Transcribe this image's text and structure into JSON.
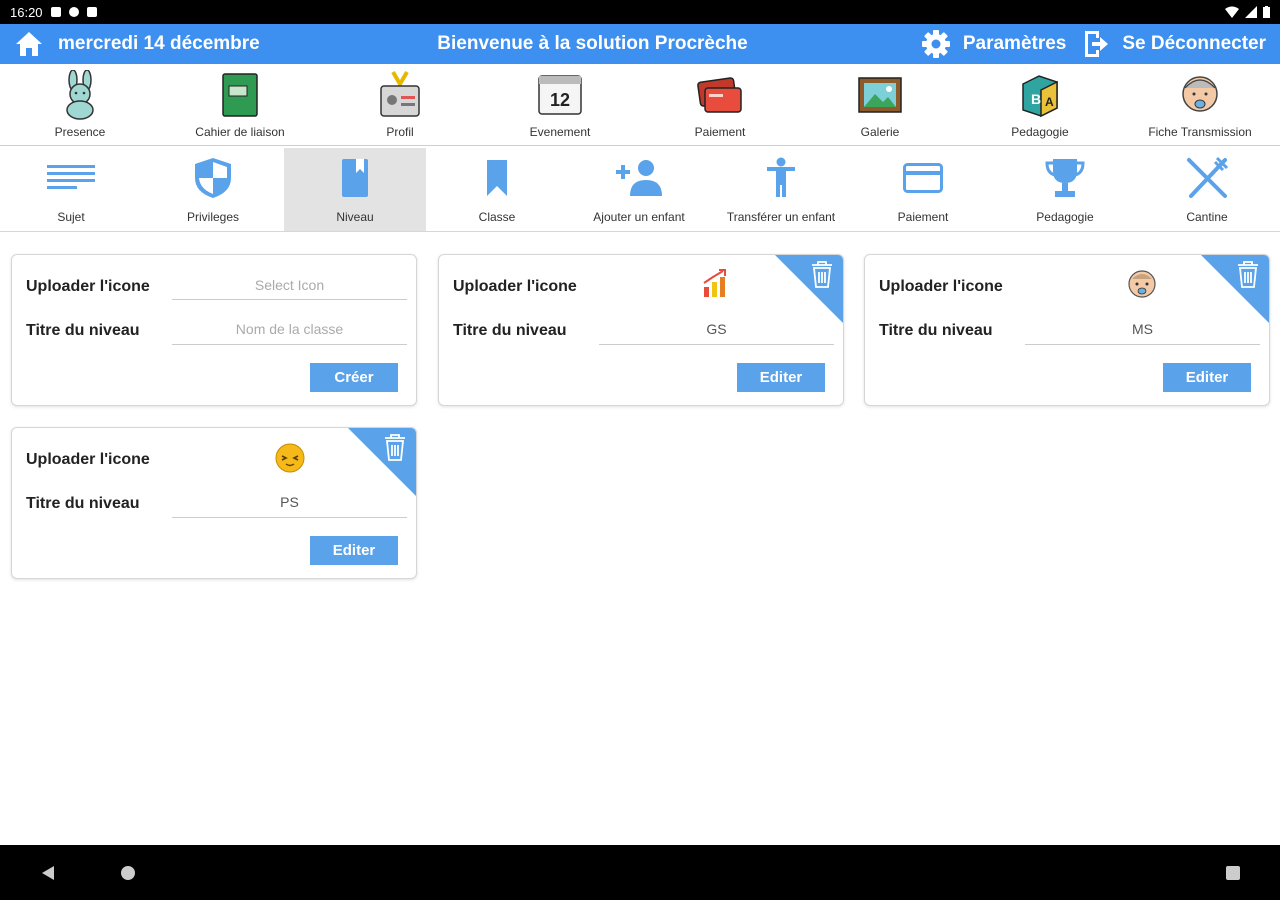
{
  "statusbar": {
    "time": "16:20"
  },
  "topbar": {
    "date": "mercredi 14 décembre",
    "title": "Bienvenue à la solution Procrèche",
    "settings": "Paramètres",
    "logout": "Se Déconnecter",
    "color": "#3d8ff0"
  },
  "modules": [
    {
      "label": "Presence",
      "icon": "bunny-icon"
    },
    {
      "label": "Cahier de liaison",
      "icon": "notebook-icon"
    },
    {
      "label": "Profil",
      "icon": "badge-icon"
    },
    {
      "label": "Evenement",
      "icon": "calendar-icon"
    },
    {
      "label": "Paiement",
      "icon": "credit-card-icon"
    },
    {
      "label": "Galerie",
      "icon": "picture-icon"
    },
    {
      "label": "Pedagogie",
      "icon": "abc-block-icon"
    },
    {
      "label": "Fiche Transmission",
      "icon": "baby-icon"
    }
  ],
  "admin_tabs": [
    {
      "label": "Sujet",
      "icon": "lines-icon"
    },
    {
      "label": "Privileges",
      "icon": "shield-icon"
    },
    {
      "label": "Niveau",
      "icon": "book-icon",
      "active": true
    },
    {
      "label": "Classe",
      "icon": "bookmark-icon"
    },
    {
      "label": "Ajouter un enfant",
      "icon": "add-person-icon"
    },
    {
      "label": "Transférer un enfant",
      "icon": "child-icon"
    },
    {
      "label": "Paiement",
      "icon": "card-icon"
    },
    {
      "label": "Pedagogie",
      "icon": "trophy-icon"
    },
    {
      "label": "Cantine",
      "icon": "utensils-icon"
    }
  ],
  "form": {
    "upload_label": "Uploader l'icone",
    "title_label": "Titre du niveau",
    "icon_placeholder": "Select Icon",
    "name_placeholder": "Nom de la classe",
    "create_button": "Créer",
    "edit_button": "Editer"
  },
  "levels": [
    {
      "name": "GS",
      "icon": "chart-icon"
    },
    {
      "name": "MS",
      "icon": "baby-face-icon"
    },
    {
      "name": "PS",
      "icon": "emoji-icon"
    }
  ],
  "accent": "#5aa2ea"
}
